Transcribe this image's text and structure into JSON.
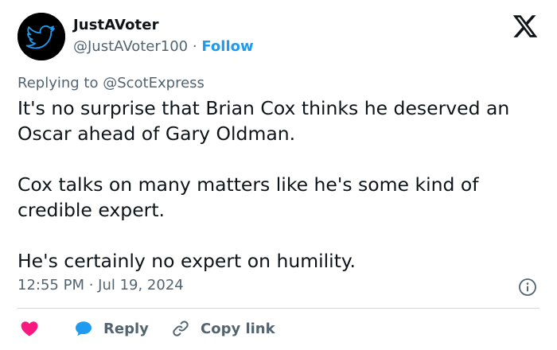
{
  "author": {
    "name": "JustAVoter",
    "handle": "@JustAVoter100",
    "separator": "·",
    "follow_label": "Follow",
    "avatar_icon": "twitter-bird-icon",
    "avatar_bg": "#000000",
    "avatar_fg": "#1d9bf0"
  },
  "brand_icon": "x-logo-icon",
  "reply_context": {
    "prefix": "Replying to",
    "target": "@ScotExpress"
  },
  "tweet": {
    "paragraphs": [
      "It's no surprise that Brian Cox thinks he deserved an Oscar ahead of Gary Oldman.",
      "Cox talks on many matters like he's some kind of credible expert.",
      "He's certainly no expert on humility."
    ]
  },
  "timestamp": "12:55 PM · Jul 19, 2024",
  "info_icon": "info-icon",
  "actions": {
    "like_icon": "heart-icon",
    "reply_icon": "speech-bubble-icon",
    "reply_label": "Reply",
    "copy_icon": "link-icon",
    "copy_label": "Copy link"
  },
  "colors": {
    "text": "#0f1419",
    "secondary": "#536471",
    "accent": "#1d9bf0",
    "like": "#f91880",
    "divider": "#cfd9de"
  }
}
